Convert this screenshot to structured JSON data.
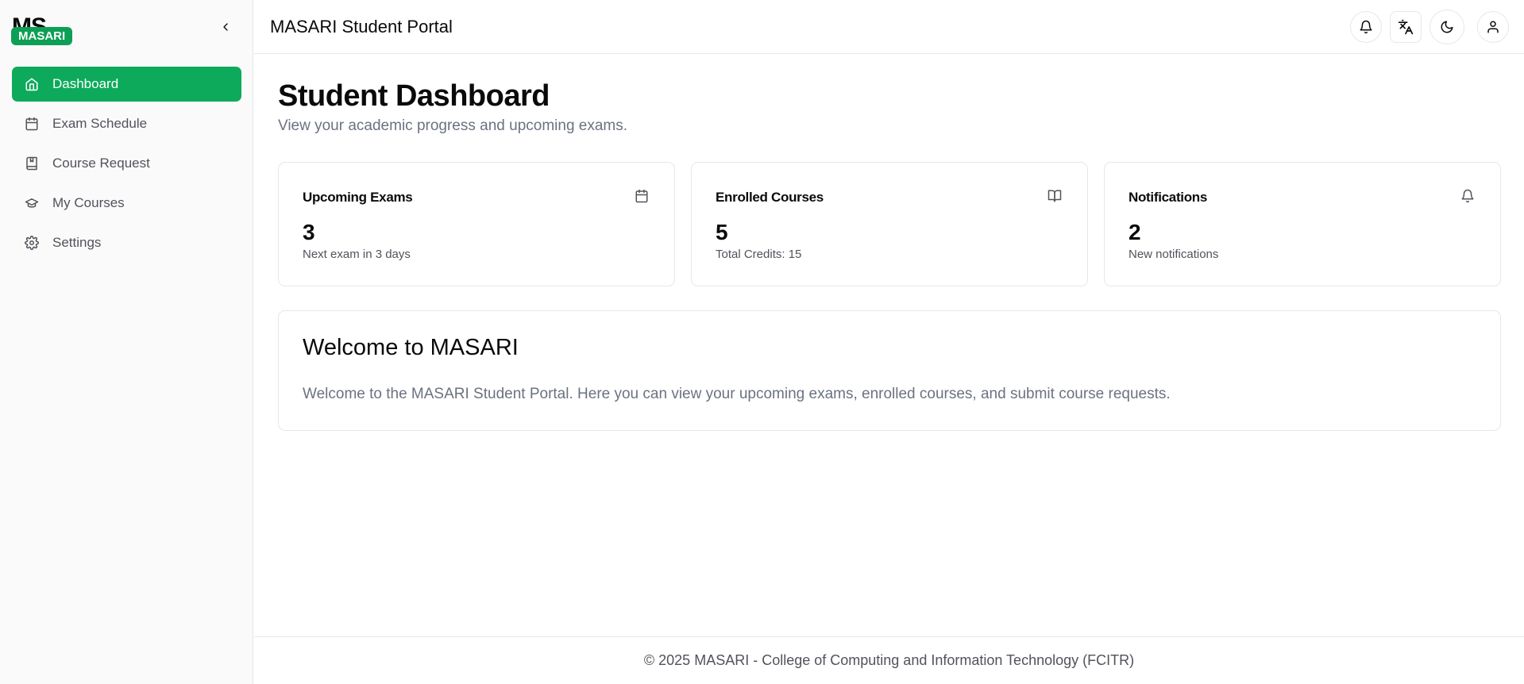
{
  "app": {
    "logo_text": "MS",
    "badge": "MASARI",
    "title": "MASARI Student Portal"
  },
  "colors": {
    "accent": "#0daa5b",
    "badge": "#0d9f55",
    "muted_text": "#6b7280"
  },
  "sidebar": {
    "collapse_icon": "chevron-left-icon",
    "items": [
      {
        "label": "Dashboard",
        "icon": "home-icon",
        "active": true
      },
      {
        "label": "Exam Schedule",
        "icon": "calendar-icon",
        "active": false
      },
      {
        "label": "Course Request",
        "icon": "book-icon",
        "active": false
      },
      {
        "label": "My Courses",
        "icon": "graduation-cap-icon",
        "active": false
      },
      {
        "label": "Settings",
        "icon": "gear-icon",
        "active": false
      }
    ]
  },
  "header": {
    "buttons": [
      "bell-icon",
      "translate-icon",
      "moon-icon",
      "user-icon"
    ]
  },
  "main": {
    "title": "Student Dashboard",
    "subtitle": "View your academic progress and upcoming exams.",
    "cards": [
      {
        "title": "Upcoming Exams",
        "value": "3",
        "note": "Next exam in 3 days",
        "icon": "calendar-icon"
      },
      {
        "title": "Enrolled Courses",
        "value": "5",
        "note": "Total Credits: 15",
        "icon": "open-book-icon"
      },
      {
        "title": "Notifications",
        "value": "2",
        "note": "New notifications",
        "icon": "bell-icon"
      }
    ],
    "welcome": {
      "title": "Welcome to MASARI",
      "text": "Welcome to the MASARI Student Portal. Here you can view your upcoming exams, enrolled courses, and submit course requests."
    }
  },
  "footer": {
    "text": "© 2025 MASARI - College of Computing and Information Technology (FCITR)"
  }
}
